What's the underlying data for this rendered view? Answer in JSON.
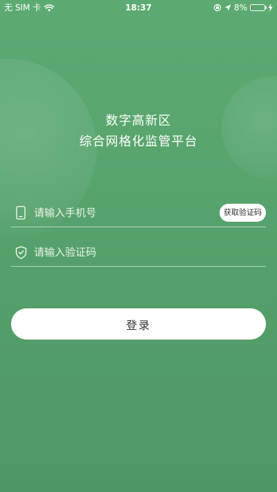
{
  "status_bar": {
    "carrier": "无 SIM 卡",
    "time": "18:37",
    "battery_percent": "8%",
    "battery_level": 0.08,
    "battery_color": "#ff3b30"
  },
  "title": {
    "line1": "数字高新区",
    "line2": "综合网格化监管平台"
  },
  "phone_input": {
    "placeholder": "请输入手机号",
    "value": "",
    "icon": "phone-icon"
  },
  "code_button": {
    "label": "获取验证码"
  },
  "code_input": {
    "placeholder": "请输入验证码",
    "value": "",
    "icon": "shield-check-icon"
  },
  "login_button": {
    "label": "登录"
  },
  "colors": {
    "background": "#58a56e",
    "button": "#ffffff",
    "button_text": "#333333"
  }
}
